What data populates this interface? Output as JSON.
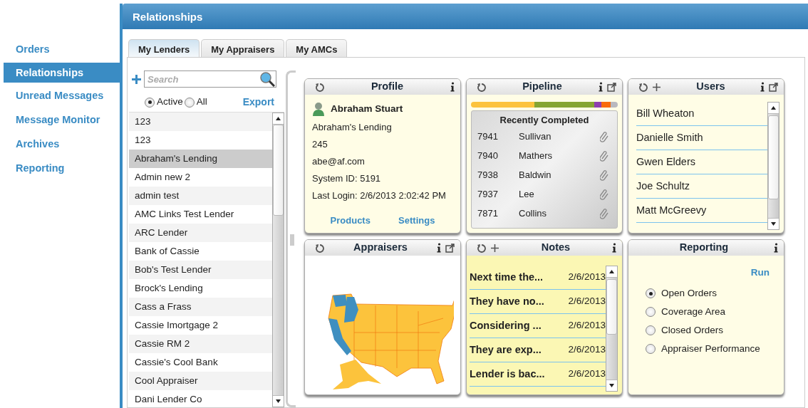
{
  "nav": {
    "items": [
      {
        "label": "Orders",
        "selected": false
      },
      {
        "label": "Relationships",
        "selected": true
      },
      {
        "label": "Unread Messages",
        "selected": false
      },
      {
        "label": "Message Monitor",
        "selected": false
      },
      {
        "label": "Archives",
        "selected": false
      },
      {
        "label": "Reporting",
        "selected": false
      }
    ]
  },
  "panel": {
    "title": "Relationships"
  },
  "tabs": [
    {
      "label": "My Lenders",
      "selected": true
    },
    {
      "label": "My Appraisers",
      "selected": false
    },
    {
      "label": "My AMCs",
      "selected": false
    }
  ],
  "lenders": {
    "search": {
      "placeholder": "Search"
    },
    "filters": [
      {
        "label": "Active",
        "selected": true
      },
      {
        "label": "All",
        "selected": false
      }
    ],
    "export": "Export",
    "items": [
      {
        "label": "123",
        "selected": false
      },
      {
        "label": "123",
        "selected": false
      },
      {
        "label": "Abraham's Lending",
        "selected": true
      },
      {
        "label": "Admin new 2",
        "selected": false
      },
      {
        "label": "admin test",
        "selected": false
      },
      {
        "label": "AMC Links Test Lender",
        "selected": false
      },
      {
        "label": "ARC Lender",
        "selected": false
      },
      {
        "label": "Bank of Cassie",
        "selected": false
      },
      {
        "label": "Bob's Test Lender",
        "selected": false
      },
      {
        "label": "Brock's Lending",
        "selected": false
      },
      {
        "label": "Cass a Frass",
        "selected": false
      },
      {
        "label": "Cassie Imortgage 2",
        "selected": false
      },
      {
        "label": "Cassie RM 2",
        "selected": false
      },
      {
        "label": "Cassie's Cool Bank",
        "selected": false
      },
      {
        "label": "Cool Appraiser",
        "selected": false
      },
      {
        "label": "Dani Lender Co",
        "selected": false
      }
    ]
  },
  "widgets": [
    {
      "kind": "profile",
      "title": "Profile",
      "refresh": true,
      "add": false,
      "popout": false,
      "name": "Abraham Stuart",
      "lines": [
        "Abraham's Lending",
        "245",
        "abe@af.com",
        "System ID: 5191",
        "Last Login: 2/6/2013 2:02:42 PM"
      ],
      "links": [
        "Products",
        "Settings"
      ]
    },
    {
      "kind": "pipeline",
      "title": "Pipeline",
      "refresh": true,
      "add": false,
      "popout": true,
      "segments": [
        {
          "color": "#fcc33c"
        },
        {
          "color": "#85a532"
        },
        {
          "color": "#8e3fb0"
        },
        {
          "color": "#f96b0a"
        },
        {
          "color": "#b9b9bf"
        }
      ],
      "recent_title": "Recently Completed",
      "rows": [
        {
          "number": "7941",
          "name": "Sullivan"
        },
        {
          "number": "7940",
          "name": "Mathers"
        },
        {
          "number": "7938",
          "name": "Baldwin"
        },
        {
          "number": "7937",
          "name": "Lee"
        },
        {
          "number": "7871",
          "name": "Collins"
        }
      ]
    },
    {
      "kind": "users",
      "title": "Users",
      "refresh": true,
      "add": true,
      "popout": true,
      "items": [
        "Bill Wheaton",
        "Danielle Smith",
        "Gwen Elders",
        "Joe Schultz",
        "Matt McGreevy"
      ]
    },
    {
      "kind": "map",
      "title": "Appraisers",
      "refresh": true,
      "add": false,
      "popout": true
    },
    {
      "kind": "notes",
      "title": "Notes",
      "refresh": true,
      "add": true,
      "popout": false,
      "rows": [
        {
          "title": "Next time the...",
          "date": "2/6/2013"
        },
        {
          "title": "They have no...",
          "date": "2/6/2013"
        },
        {
          "title": "Considering ...",
          "date": "2/6/2013"
        },
        {
          "title": "They are exp...",
          "date": "2/6/2013"
        },
        {
          "title": "Lender is bac...",
          "date": "2/6/2013"
        }
      ]
    },
    {
      "kind": "reporting",
      "title": "Reporting",
      "refresh": false,
      "add": false,
      "popout": false,
      "run": "Run",
      "options": [
        {
          "label": "Open Orders",
          "selected": true
        },
        {
          "label": "Coverage Area",
          "selected": false
        },
        {
          "label": "Closed Orders",
          "selected": false
        },
        {
          "label": "Appraiser Performance",
          "selected": false
        }
      ]
    }
  ]
}
